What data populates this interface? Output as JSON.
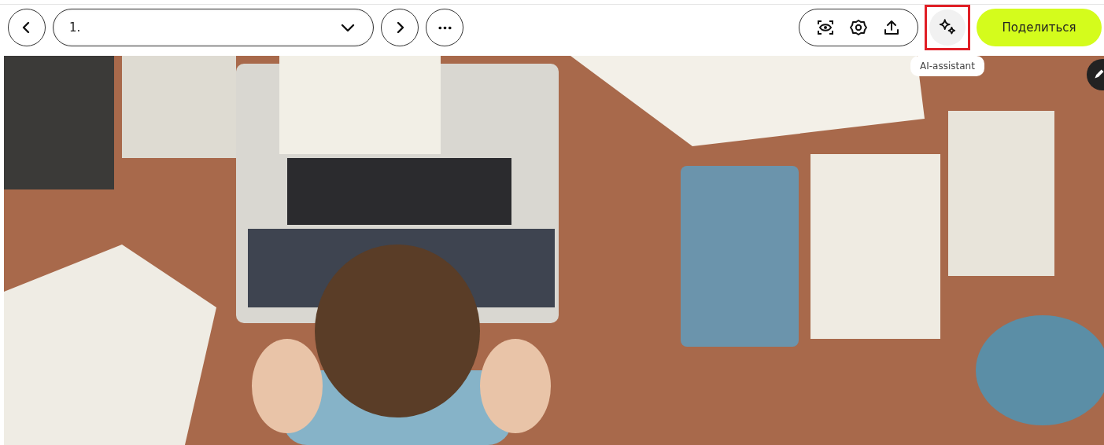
{
  "toolbar": {
    "slide_select": {
      "value": "1."
    },
    "ai_button": {
      "highlighted": true,
      "tooltip": "AI-assistant"
    },
    "share_button": "Поделиться"
  }
}
